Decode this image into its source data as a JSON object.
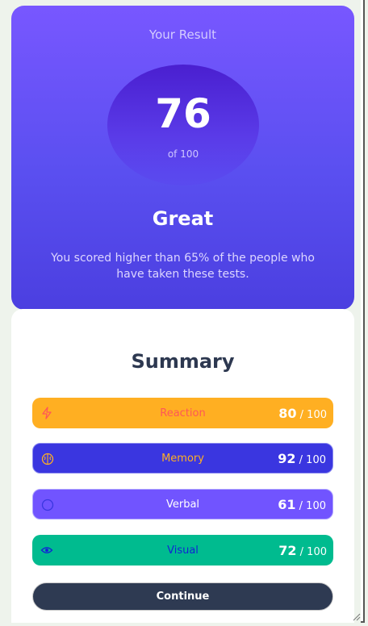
{
  "result": {
    "title": "Your Result",
    "score": "76",
    "score_max": "of 100",
    "rating": "Great",
    "description": "You scored higher than 65% of the people who have taken these tests."
  },
  "summary": {
    "title": "Summary",
    "items": [
      {
        "label": "Reaction",
        "score": "80",
        "max": " / 100",
        "icon": "lightning-icon",
        "color": "#ffaf22",
        "label_color": "#ff5757"
      },
      {
        "label": "Memory",
        "score": "92",
        "max": " / 100",
        "icon": "brain-icon",
        "color": "#3a36e0",
        "label_color": "#ffaf22"
      },
      {
        "label": "Verbal",
        "score": "61",
        "max": " / 100",
        "icon": "chat-icon",
        "color": "#7154ff",
        "label_color": "#ffffff"
      },
      {
        "label": "Visual",
        "score": "72",
        "max": " / 100",
        "icon": "eye-icon",
        "color": "#00bb8f",
        "label_color": "#1125d4"
      }
    ],
    "continue_label": "Continue"
  }
}
